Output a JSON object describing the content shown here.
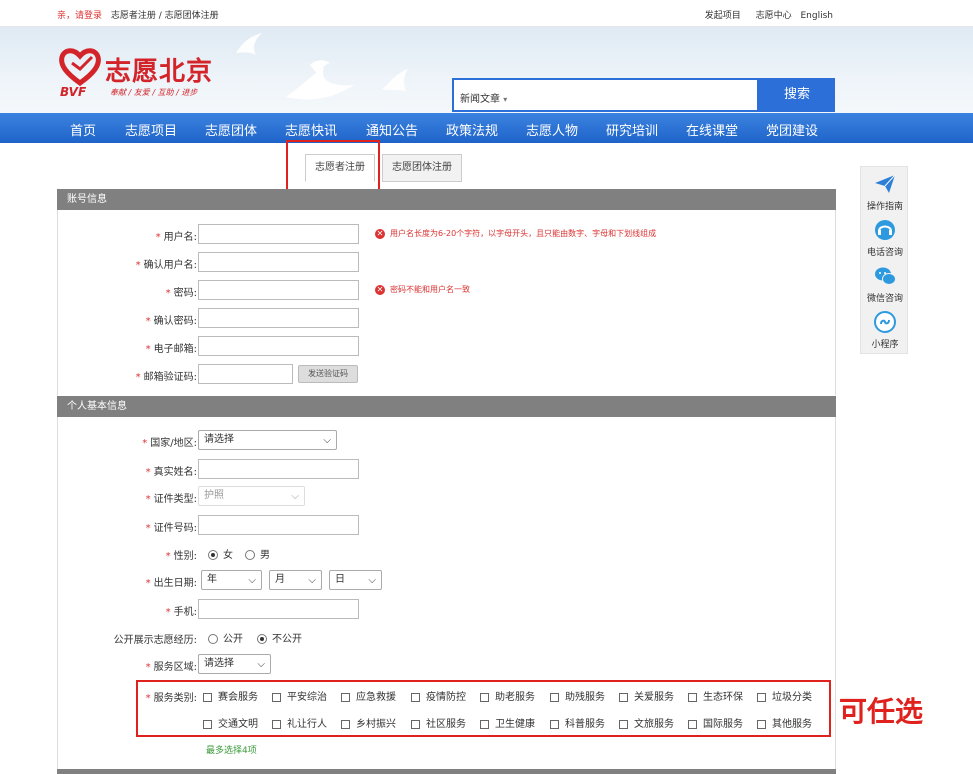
{
  "topbar": {
    "greeting": "亲，请登录",
    "breadcrumb": "志愿者注册 / 志愿团体注册",
    "links": [
      "发起项目",
      "志愿中心",
      "English"
    ]
  },
  "header": {
    "logo_cn": "志愿北京",
    "logo_en": "BVF",
    "logo_slogan": "奉献 / 友爱 / 互助 / 进步",
    "search": {
      "category": "新闻文章",
      "button": "搜索"
    }
  },
  "nav": [
    "首页",
    "志愿项目",
    "志愿团体",
    "志愿快讯",
    "通知公告",
    "政策法规",
    "志愿人物",
    "研究培训",
    "在线课堂",
    "党团建设"
  ],
  "tabs": [
    {
      "label": "志愿者注册",
      "active": true
    },
    {
      "label": "志愿团体注册",
      "active": false
    }
  ],
  "account": {
    "title": "账号信息",
    "fields": [
      {
        "label": "用户名:",
        "required": true
      },
      {
        "label": "确认用户名:",
        "required": true
      },
      {
        "label": "密码:",
        "required": true
      },
      {
        "label": "确认密码:",
        "required": true
      },
      {
        "label": "电子邮箱:",
        "required": true
      },
      {
        "label": "邮箱验证码:",
        "required": true
      }
    ],
    "error_username": "用户名长度为6-20个字符，以字母开头，且只能由数字、字母和下划线组成",
    "error_password": "密码不能和用户名一致",
    "send_code": "发送验证码"
  },
  "personal": {
    "title": "个人基本信息",
    "country_label": "国家/地区:",
    "country_value": "请选择",
    "name_label": "真实姓名:",
    "idtype_label": "证件类型:",
    "idtype_value": "护照",
    "idnum_label": "证件号码:",
    "gender_label": "性别:",
    "gender_options": [
      "女",
      "男"
    ],
    "gender_selected": "女",
    "birth_label": "出生日期:",
    "birth_year": "年",
    "birth_month": "月",
    "birth_day": "日",
    "phone_label": "手机:",
    "public_label": "公开展示志愿经历:",
    "public_options": [
      "公开",
      "不公开"
    ],
    "public_selected": "不公开",
    "region_label": "服务区域:",
    "region_value": "请选择",
    "service_label": "服务类别:",
    "services": [
      "赛会服务",
      "平安综治",
      "应急救援",
      "疫情防控",
      "助老服务",
      "助残服务",
      "关爱服务",
      "生态环保",
      "垃圾分类",
      "交通文明",
      "礼让行人",
      "乡村振兴",
      "社区服务",
      "卫生健康",
      "科普服务",
      "文旅服务",
      "国际服务",
      "其他服务"
    ],
    "max_note": "最多选择4项"
  },
  "side": [
    "操作指南",
    "电话咨询",
    "微信咨询",
    "小程序"
  ],
  "annotation": "可任选",
  "colors": {
    "brand_red": "#d3242a",
    "nav_blue": "#1f63c9",
    "section_gray": "#808080",
    "mark_red": "#e0221f"
  }
}
